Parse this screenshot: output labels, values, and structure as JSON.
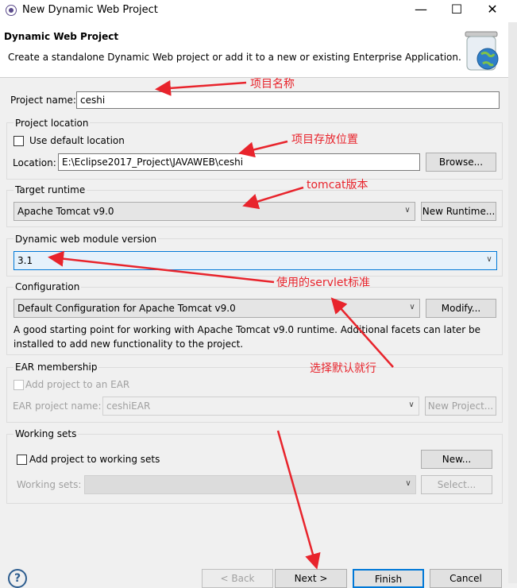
{
  "window": {
    "title": "New Dynamic Web Project",
    "minimize": "—",
    "maximize": "☐",
    "close": "✕"
  },
  "header": {
    "title": "Dynamic Web Project",
    "description": "Create a standalone Dynamic Web project or add it to a new or existing Enterprise Application."
  },
  "project_name": {
    "label": "Project name:",
    "value": "ceshi"
  },
  "project_location": {
    "group_label": "Project location",
    "use_default_label": "Use default location",
    "use_default_checked": false,
    "location_label": "Location:",
    "location_value": "E:\\Eclipse2017_Project\\JAVAWEB\\ceshi",
    "browse_label": "Browse..."
  },
  "target_runtime": {
    "group_label": "Target runtime",
    "selected": "Apache Tomcat v9.0",
    "new_runtime_label": "New Runtime..."
  },
  "module_version": {
    "group_label": "Dynamic web module version",
    "selected": "3.1"
  },
  "configuration": {
    "group_label": "Configuration",
    "selected": "Default Configuration for Apache Tomcat v9.0",
    "modify_label": "Modify...",
    "desc_line1": "A good starting point for working with Apache Tomcat v9.0 runtime. Additional facets can later be",
    "desc_line2": "installed to add new functionality to the project."
  },
  "ear": {
    "group_label": "EAR membership",
    "add_label": "Add project to an EAR",
    "ear_name_label": "EAR project name:",
    "ear_name_value": "ceshiEAR",
    "new_project_label": "New Project..."
  },
  "working_sets": {
    "group_label": "Working sets",
    "add_label": "Add project to working sets",
    "new_label": "New...",
    "sets_label": "Working sets:",
    "select_label": "Select..."
  },
  "footer": {
    "help": "?",
    "back": "< Back",
    "next": "Next >",
    "finish": "Finish",
    "cancel": "Cancel"
  },
  "annotations": {
    "a1": "项目名称",
    "a2": "项目存放位置",
    "a3": "tomcat版本",
    "a4": "使用的servlet标准",
    "a5": "选择默认就行"
  },
  "colors": {
    "annotation": "#e8242c",
    "focus_border": "#0078d7",
    "focus_bg": "#e5f1fb",
    "primary_button": "#0078d7"
  }
}
